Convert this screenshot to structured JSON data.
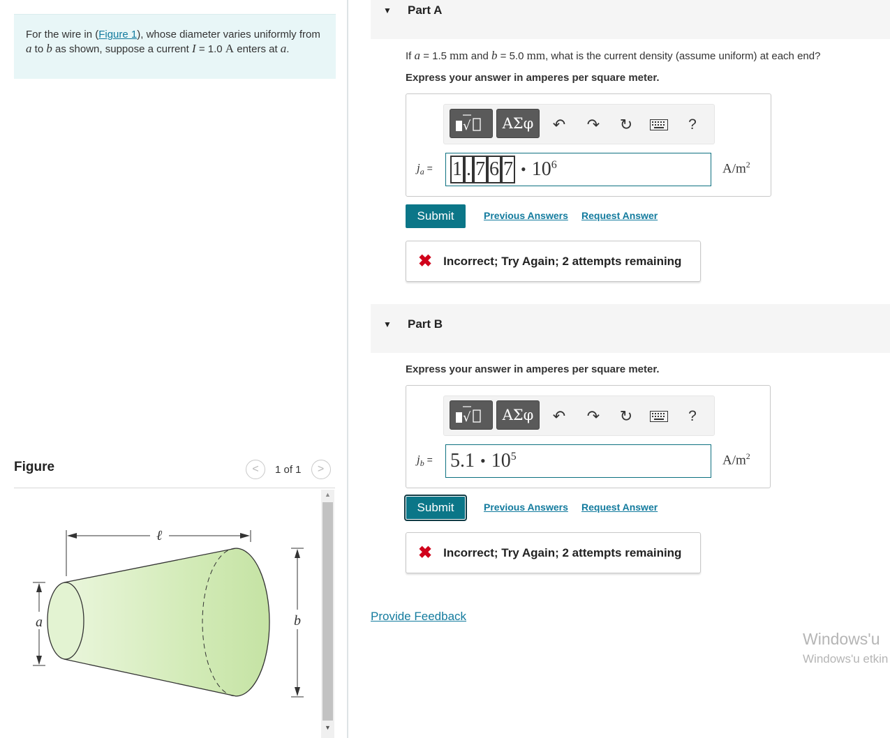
{
  "problem": {
    "text_before_link": "For the wire in (",
    "figure_link": "Figure 1",
    "text_after_link": "), whose diameter varies uniformly from",
    "var_a": "a",
    "to": "to",
    "var_b": "b",
    "text_mid": "as shown, suppose a current",
    "var_I": "I",
    "equals": "=",
    "current_value": "1.0",
    "current_unit": "A",
    "enters_at": "enters at",
    "period": "."
  },
  "figure": {
    "heading": "Figure",
    "pager_text": "1 of 1",
    "prev_glyph": "<",
    "next_glyph": ">",
    "labels": {
      "length": "ℓ",
      "a": "a",
      "b": "b"
    },
    "fill_color": "#dcefc5"
  },
  "part_a": {
    "title": "Part A",
    "question": {
      "if": "If",
      "a": "a",
      "eq1": "=",
      "a_value": "1.5",
      "a_unit": "mm",
      "and": "and",
      "b": "b",
      "eq2": "=",
      "b_value": "5.0",
      "b_unit": "mm",
      "rest": ", what is the current density (assume uniform) at each end?"
    },
    "instruction": "Express your answer in amperes per square meter.",
    "variable": "j",
    "variable_sub": "a",
    "equals": "=",
    "answer_digits": [
      "1",
      ".",
      "7",
      "6",
      "7"
    ],
    "times": "•",
    "base": "10",
    "exponent": "6",
    "unit": "A/m",
    "unit_exp": "2",
    "submit_label": "Submit",
    "previous_answers": "Previous Answers",
    "request_answer": "Request Answer",
    "feedback_icon": "✖",
    "feedback": "Incorrect; Try Again; 2 attempts remaining"
  },
  "part_b": {
    "title": "Part B",
    "instruction": "Express your answer in amperes per square meter.",
    "variable": "j",
    "variable_sub": "b",
    "equals": "=",
    "answer_mantissa": "5.1",
    "times": "•",
    "base": "10",
    "exponent": "5",
    "unit": "A/m",
    "unit_exp": "2",
    "submit_label": "Submit",
    "previous_answers": "Previous Answers",
    "request_answer": "Request Answer",
    "feedback_icon": "✖",
    "feedback": "Incorrect; Try Again; 2 attempts remaining"
  },
  "toolbar": {
    "templates_icon": "templates-icon",
    "greek_label": "ΑΣφ",
    "undo_icon": "undo-icon",
    "redo_icon": "redo-icon",
    "reset_icon": "reset-icon",
    "keyboard_icon": "keyboard-icon",
    "help_label": "?"
  },
  "footer": {
    "provide_feedback": "Provide Feedback",
    "watermark_line1": "Windows'u",
    "watermark_line2": "Windows'u etkin"
  },
  "colors": {
    "accent": "#0b7688",
    "link": "#137b9e",
    "error": "#d0021b",
    "problem_bg": "#e8f6f7"
  }
}
